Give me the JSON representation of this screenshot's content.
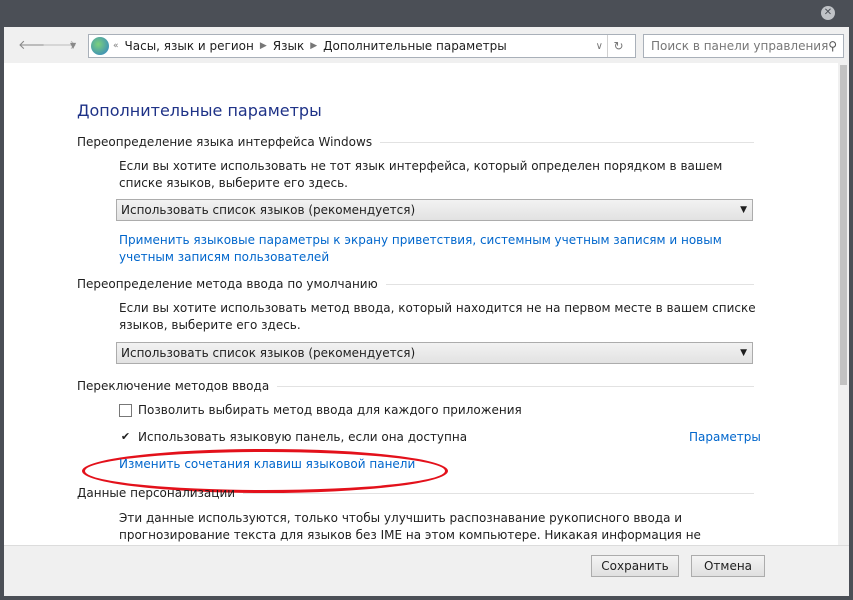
{
  "breadcrumb": {
    "overflow": "«",
    "items": [
      "Часы, язык и регион",
      "Язык",
      "Дополнительные параметры"
    ]
  },
  "search": {
    "placeholder": "Поиск в панели управления"
  },
  "page_title": "Дополнительные параметры",
  "ui_language": {
    "heading": "Переопределение языка интерфейса Windows",
    "desc": "Если вы хотите использовать не тот язык интерфейса, который определен порядком в вашем списке языков, выберите его здесь.",
    "selected": "Использовать список языков (рекомендуется)",
    "link": "Применить языковые параметры к экрану приветствия, системным учетным записям и новым учетным записям пользователей"
  },
  "input_method": {
    "heading": "Переопределение метода ввода по умолчанию",
    "desc": "Если вы хотите использовать метод ввода, который находится не на первом месте в вашем списке языков, выберите его здесь.",
    "selected": "Использовать список языков (рекомендуется)"
  },
  "switching": {
    "heading": "Переключение методов ввода",
    "cb1": {
      "label": "Позволить выбирать метод ввода для каждого приложения",
      "checked": false
    },
    "cb2": {
      "label": "Использовать языковую панель, если она доступна",
      "checked": true
    },
    "options_link": "Параметры",
    "hotkeys_link": "Изменить сочетания клавиш языковой панели"
  },
  "personalization": {
    "heading": "Данные персонализации",
    "desc": "Эти данные используются, только чтобы улучшить распознавание рукописного ввода и прогнозирование текста для языков без IME на этом компьютере. Никакая информация не отправляется в корпорацию Майкрософт."
  },
  "footer": {
    "save": "Сохранить",
    "cancel": "Отмена"
  },
  "colors": {
    "annotation": "#e3111b",
    "link": "#0066cc",
    "title": "#1e3287"
  }
}
